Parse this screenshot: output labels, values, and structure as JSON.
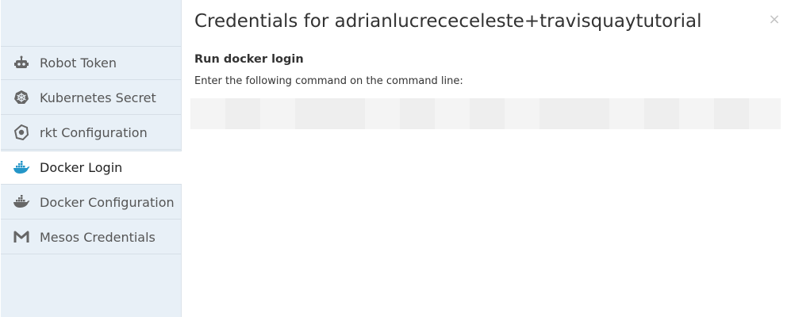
{
  "sidebar": {
    "items": [
      {
        "label": "Robot Token",
        "icon": "robot-icon",
        "active": false
      },
      {
        "label": "Kubernetes Secret",
        "icon": "kubernetes-icon",
        "active": false
      },
      {
        "label": "rkt Configuration",
        "icon": "rkt-icon",
        "active": false
      },
      {
        "label": "Docker Login",
        "icon": "docker-icon",
        "active": true
      },
      {
        "label": "Docker Configuration",
        "icon": "docker-icon",
        "active": false
      },
      {
        "label": "Mesos Credentials",
        "icon": "mesos-icon",
        "active": false
      }
    ]
  },
  "modal": {
    "title": "Credentials for adrianlucrececeleste+travisquaytutorial",
    "close_label": "×"
  },
  "section": {
    "title": "Run docker login",
    "description": "Enter the following command on the command line:"
  },
  "command": {
    "value": ""
  },
  "colors": {
    "sidebar_bg": "#e8f0f7",
    "active_bg": "#ffffff",
    "docker_blue": "#2496c8",
    "icon_gray": "#666666",
    "command_bg": "#f4f4f4"
  }
}
